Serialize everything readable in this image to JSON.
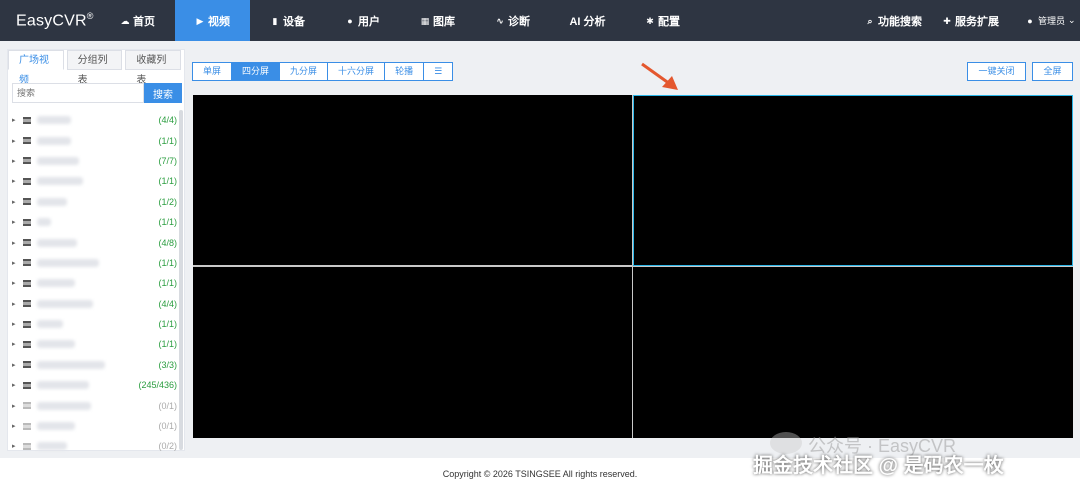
{
  "app": {
    "name": "EasyCVR",
    "mark": "®"
  },
  "nav": {
    "items": [
      {
        "label": "首页",
        "icon": "cloud-icon"
      },
      {
        "label": "视频",
        "icon": "play-icon",
        "active": true
      },
      {
        "label": "设备",
        "icon": "device-icon"
      },
      {
        "label": "用户",
        "icon": "user-icon"
      },
      {
        "label": "图库",
        "icon": "gallery-icon"
      },
      {
        "label": "诊断",
        "icon": "pulse-icon"
      },
      {
        "label": "AI 分析",
        "icon": ""
      },
      {
        "label": "配置",
        "icon": "gear-icon"
      }
    ],
    "search_label": "功能搜索",
    "extend_label": "服务扩展",
    "user_label": "管理员"
  },
  "sidebar": {
    "tabs": [
      "广场视频",
      "分组列表",
      "收藏列表"
    ],
    "search_placeholder": "搜索",
    "search_button": "搜索",
    "groups": [
      {
        "count": "(4/4)"
      },
      {
        "count": "(1/1)"
      },
      {
        "count": "(7/7)"
      },
      {
        "count": "(1/1)"
      },
      {
        "count": "(1/2)"
      },
      {
        "count": "(1/1)"
      },
      {
        "count": "(4/8)"
      },
      {
        "count": "(1/1)"
      },
      {
        "count": "(1/1)"
      },
      {
        "count": "(4/4)"
      },
      {
        "count": "(1/1)"
      },
      {
        "count": "(1/1)"
      },
      {
        "count": "(3/3)"
      },
      {
        "count": "(245/436)"
      },
      {
        "count": "(0/1)",
        "offline": true
      },
      {
        "count": "(0/1)",
        "offline": true
      },
      {
        "count": "(0/2)",
        "offline": true
      }
    ]
  },
  "toolbar": {
    "layouts": [
      "单屏",
      "四分屏",
      "九分屏",
      "十六分屏",
      "轮播"
    ],
    "active_layout": "四分屏",
    "close_all": "一键关闭",
    "fullscreen": "全屏"
  },
  "colors": {
    "accent": "#3a8ee6",
    "nav_bg": "#2e3542",
    "selected_border": "#2bb6e8",
    "online": "#2a9d3f"
  },
  "footer": {
    "copyright": "Copyright © 2026 TSINGSEE All rights reserved."
  },
  "watermark": {
    "line1": "公众号 · EasyCVR",
    "line2": "掘金技术社区 @ 是码农一枚"
  }
}
